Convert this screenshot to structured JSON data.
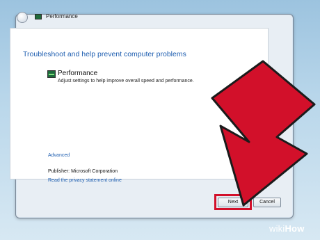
{
  "window": {
    "title": "Performance"
  },
  "content": {
    "heading": "Troubleshoot and help prevent computer problems",
    "item_title": "Performance",
    "item_description": "Adjust settings to help improve overall speed and performance.",
    "advanced_link": "Advanced",
    "publisher": "Publisher:  Microsoft Corporation",
    "privacy_link": "Read the privacy statement online"
  },
  "buttons": {
    "next": "Next",
    "cancel": "Cancel"
  },
  "annotation": {
    "arrow_color": "#d2102a",
    "highlight_color": "#d2102a"
  },
  "watermark": {
    "prefix": "wiki",
    "suffix": "How"
  },
  "icons": {
    "back": "back-arrow-icon",
    "title": "performance-icon",
    "item": "performance-icon"
  }
}
